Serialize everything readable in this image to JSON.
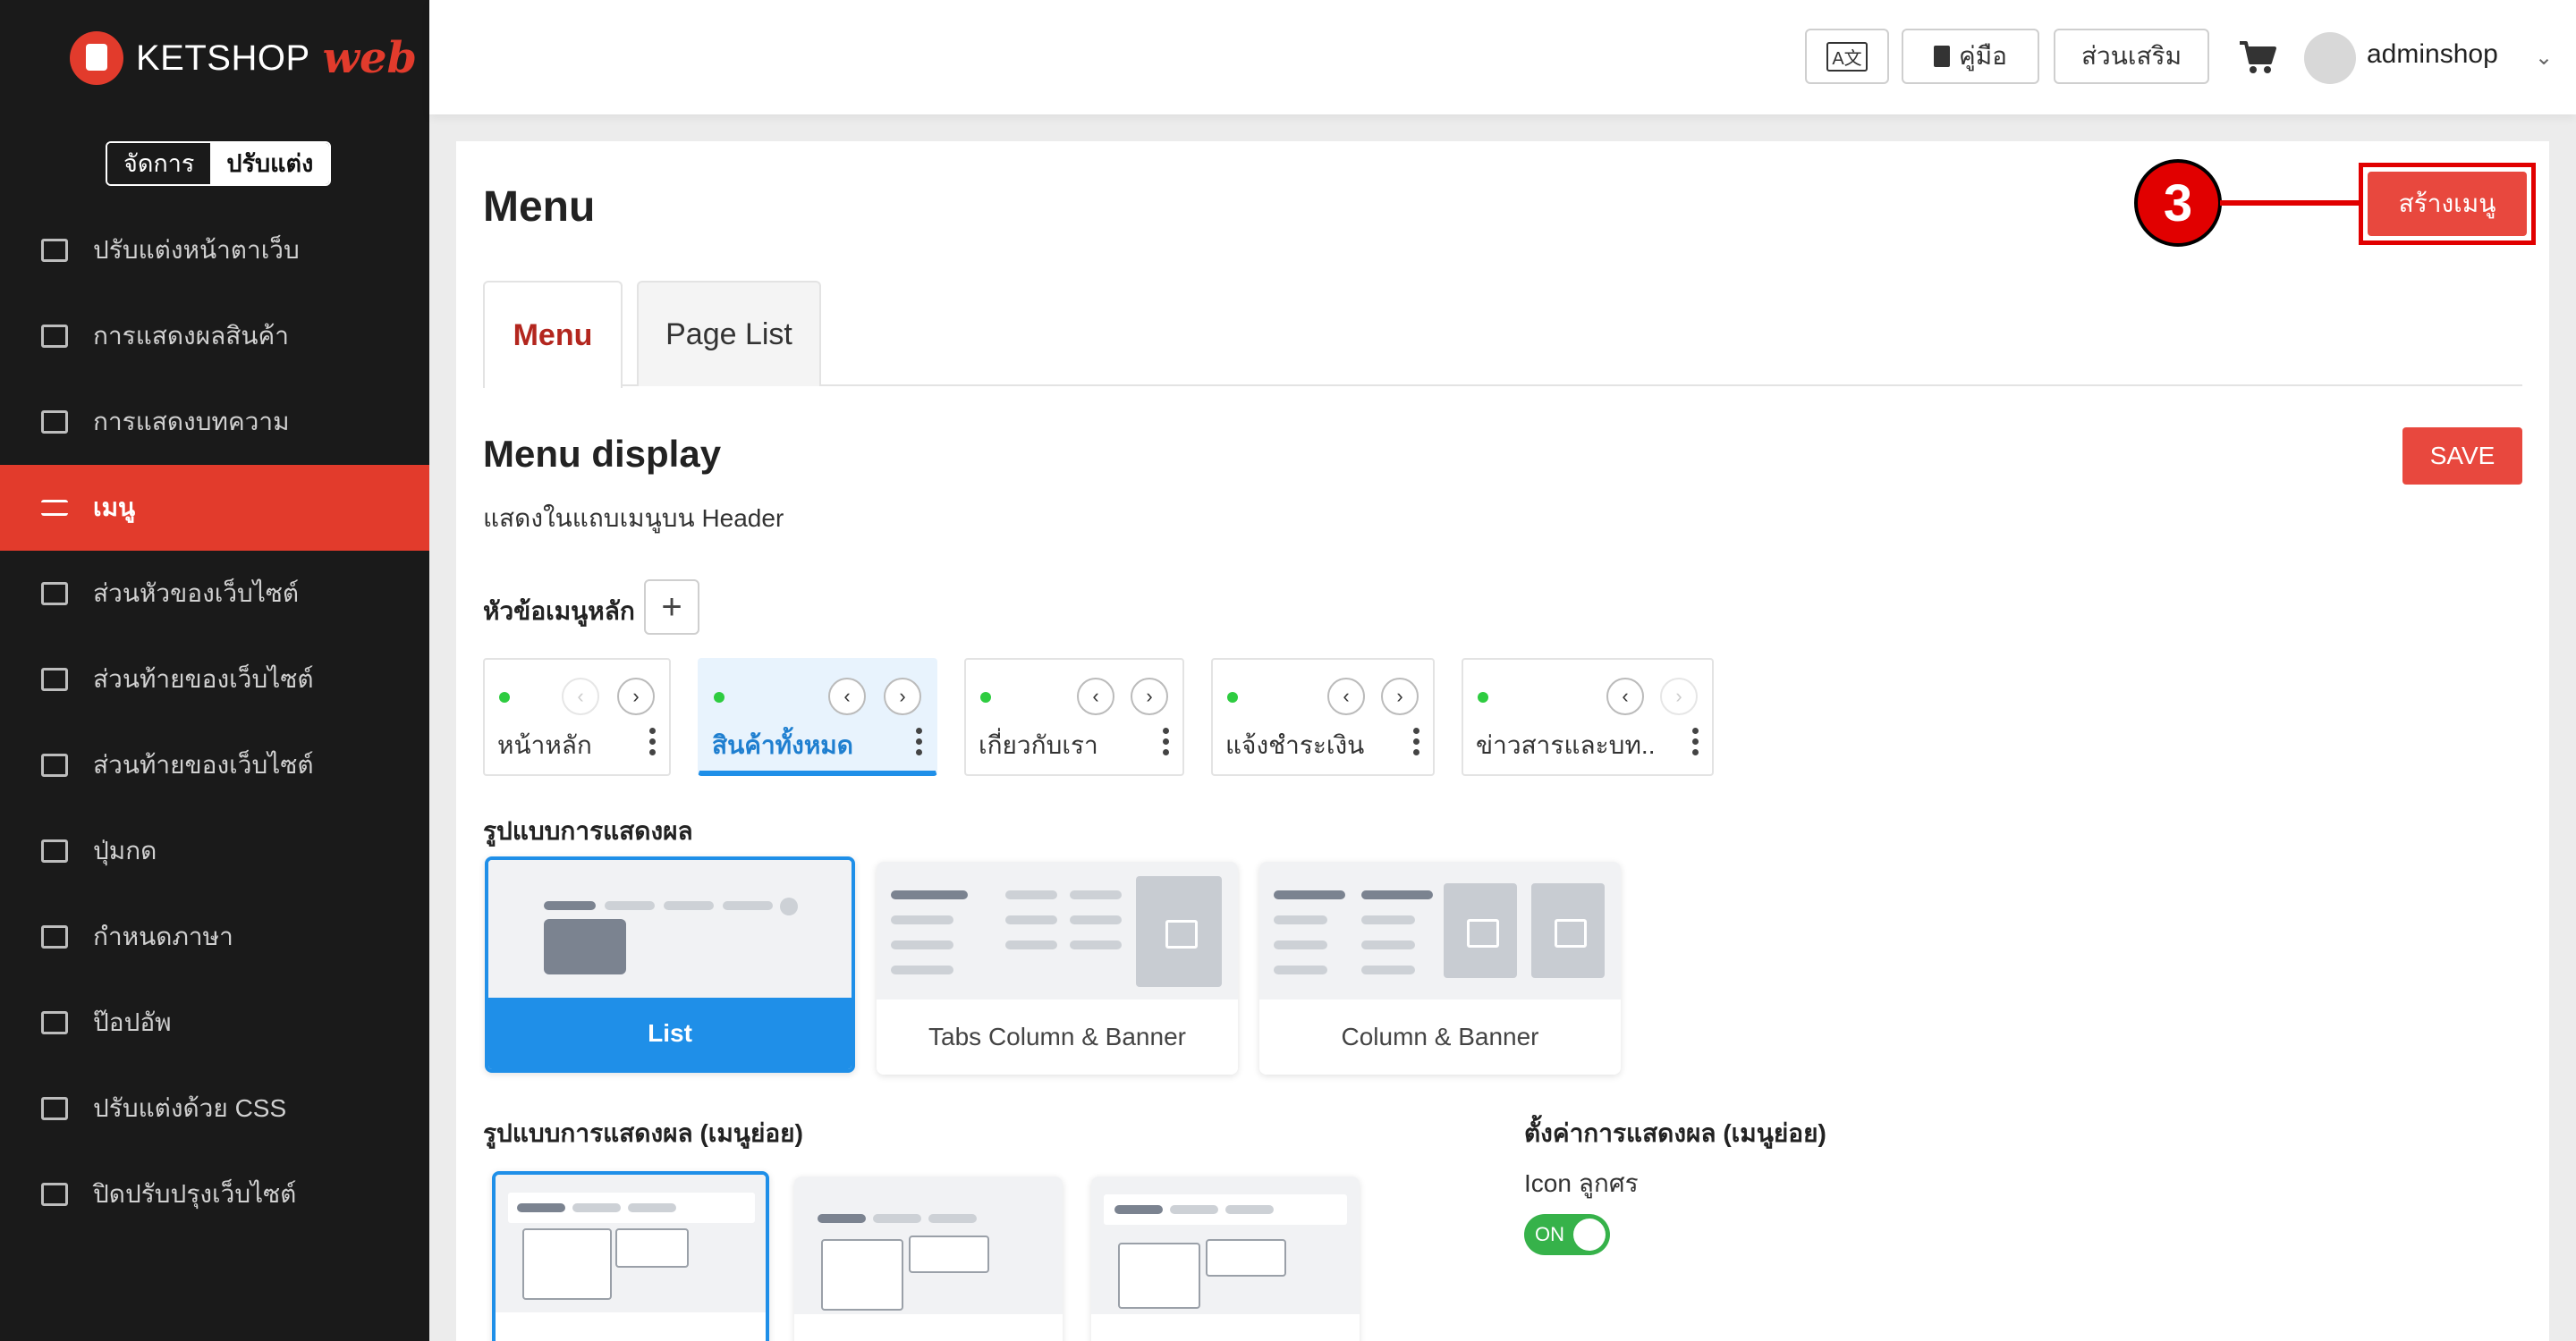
{
  "brand": {
    "name": "KETSHOP",
    "suffix": "web"
  },
  "mode_switch": {
    "manage": "จัดการ",
    "customize": "ปรับแต่ง"
  },
  "sidebar": {
    "items": [
      {
        "label": "ปรับแต่งหน้าตาเว็บ",
        "icon": "layout-icon"
      },
      {
        "label": "การแสดงผลสินค้า",
        "icon": "grid-icon"
      },
      {
        "label": "การแสดงบทความ",
        "icon": "article-icon"
      },
      {
        "label": "เมนู",
        "icon": "menu-icon",
        "active": true
      },
      {
        "label": "ส่วนหัวของเว็บไซต์",
        "icon": "header-icon"
      },
      {
        "label": "ส่วนท้ายของเว็บไซต์",
        "icon": "footer-icon"
      },
      {
        "label": "ส่วนท้ายของเว็บไซต์",
        "icon": "sidebar-icon"
      },
      {
        "label": "ปุ่มกด",
        "icon": "toggle-icon"
      },
      {
        "label": "กำหนดภาษา",
        "icon": "language-icon"
      },
      {
        "label": "ป๊อปอัพ",
        "icon": "popup-icon"
      },
      {
        "label": "ปรับแต่งด้วย CSS",
        "icon": "css-icon"
      },
      {
        "label": "ปิดปรับปรุงเว็บไซต์",
        "icon": "bug-icon"
      }
    ]
  },
  "topbar": {
    "lang_label": "A文",
    "manual_label": "คู่มือ",
    "addons_label": "ส่วนเสริม",
    "username": "adminshop"
  },
  "page": {
    "title": "Menu",
    "create_label": "สร้างเมนู",
    "step_number": "3",
    "tabs": [
      "Menu",
      "Page List"
    ],
    "section_title": "Menu display",
    "section_sub": "แสดงในแถบเมนูบน Header",
    "save_label": "SAVE",
    "main_menu_label": "หัวข้อเมนูหลัก",
    "menu_items": [
      {
        "label": "หน้าหลัก"
      },
      {
        "label": "สินค้าทั้งหมด",
        "active": true
      },
      {
        "label": "เกี่ยวกับเรา"
      },
      {
        "label": "แจ้งชำระเงิน"
      },
      {
        "label": "ข่าวสารและบท.."
      }
    ],
    "display_style_label": "รูปแบบการแสดงผล",
    "display_styles": [
      "List",
      "Tabs Column & Banner",
      "Column & Banner"
    ],
    "sub_display_style_label": "รูปแบบการแสดงผล (เมนูย่อย)",
    "sub_settings_label": "ตั้งค่าการแสดงผล (เมนูย่อย)",
    "icon_arrow_label": "Icon ลูกศร",
    "toggle_on": "ON"
  },
  "colors": {
    "accent": "#e23b2c",
    "primary_blue": "#1f8fe8",
    "toggle_on": "#36b24a"
  }
}
